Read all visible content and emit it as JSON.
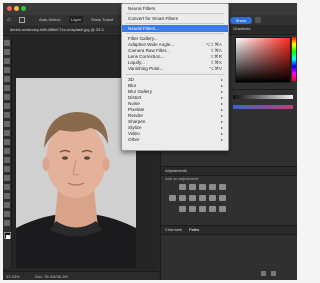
{
  "menu": {
    "items": [
      {
        "label": "Neural Filters",
        "shortcut": "",
        "submenu": false
      },
      {
        "label": "Convert for Smart Filters",
        "shortcut": "",
        "submenu": false
      },
      {
        "label": "Neural Filters...",
        "shortcut": "",
        "submenu": false,
        "highlighted": true
      },
      {
        "label": "Filter Gallery...",
        "shortcut": "",
        "submenu": false
      },
      {
        "label": "Adaptive Wide Angle...",
        "shortcut": "⌥⇧⌘A",
        "submenu": false
      },
      {
        "label": "Camera Raw Filter...",
        "shortcut": "⇧⌘A",
        "submenu": false
      },
      {
        "label": "Lens Correction...",
        "shortcut": "⇧⌘R",
        "submenu": false
      },
      {
        "label": "Liquify...",
        "shortcut": "⇧⌘X",
        "submenu": false
      },
      {
        "label": "Vanishing Point...",
        "shortcut": "⌥⌘V",
        "submenu": false
      },
      {
        "label": "3D",
        "shortcut": "",
        "submenu": true
      },
      {
        "label": "Blur",
        "shortcut": "",
        "submenu": true
      },
      {
        "label": "Blur Gallery",
        "shortcut": "",
        "submenu": true
      },
      {
        "label": "Distort",
        "shortcut": "",
        "submenu": true
      },
      {
        "label": "Noise",
        "shortcut": "",
        "submenu": true
      },
      {
        "label": "Pixelate",
        "shortcut": "",
        "submenu": true
      },
      {
        "label": "Render",
        "shortcut": "",
        "submenu": true
      },
      {
        "label": "Sharpen",
        "shortcut": "",
        "submenu": true
      },
      {
        "label": "Stylize",
        "shortcut": "",
        "submenu": true
      },
      {
        "label": "Video",
        "shortcut": "",
        "submenu": true
      },
      {
        "label": "Other",
        "shortcut": "",
        "submenu": true
      }
    ]
  },
  "optionsbar": {
    "auto_select": "Auto-Select:",
    "layer": "Layer",
    "show_transform": "Show Transf",
    "share": "Share"
  },
  "document": {
    "tab_title": "derick-mckinney-k8fr-8BihKT4o-unsplash.jpg @ 33.3"
  },
  "status": {
    "zoom": "33.33%",
    "doc_size": "Doc: 35.2M/35.2M"
  },
  "panels": {
    "gradients": "Gradients",
    "adjustments_tab": "Adjustments",
    "add_adjustment": "Add an adjustment",
    "channels_tab": "Channels",
    "paths_tab": "Paths"
  },
  "colors": {
    "menu_highlight": "#3b7ae8",
    "share": "#2f6fd6"
  }
}
